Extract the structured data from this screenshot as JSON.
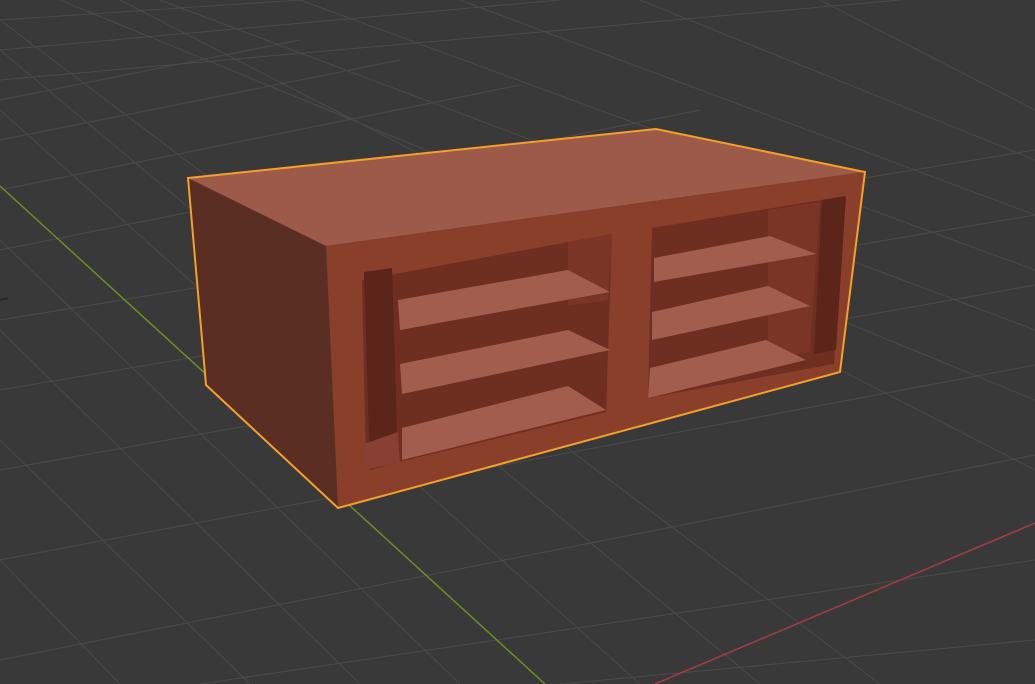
{
  "app": {
    "name": "",
    "view": "3d-viewport"
  },
  "viewport": {
    "background_color": "#393939",
    "grid_color": "#4a4a4a",
    "x_axis_color": "#a33b45",
    "y_axis_color": "#6b8e23",
    "selection_outline_color": "#f5a02a"
  },
  "object": {
    "type": "mesh",
    "description_shape": "box-shelf-cabinet",
    "selected": true,
    "material_colors": {
      "top": "#9e5a48",
      "front": "#8a3f2b",
      "side": "#5a2e22",
      "interior_back": "#6e2f21",
      "shelf_top": "#a35d4c",
      "shelf_front": "#874033"
    },
    "shelf_sections": 2,
    "shelves_per_section": 3
  }
}
